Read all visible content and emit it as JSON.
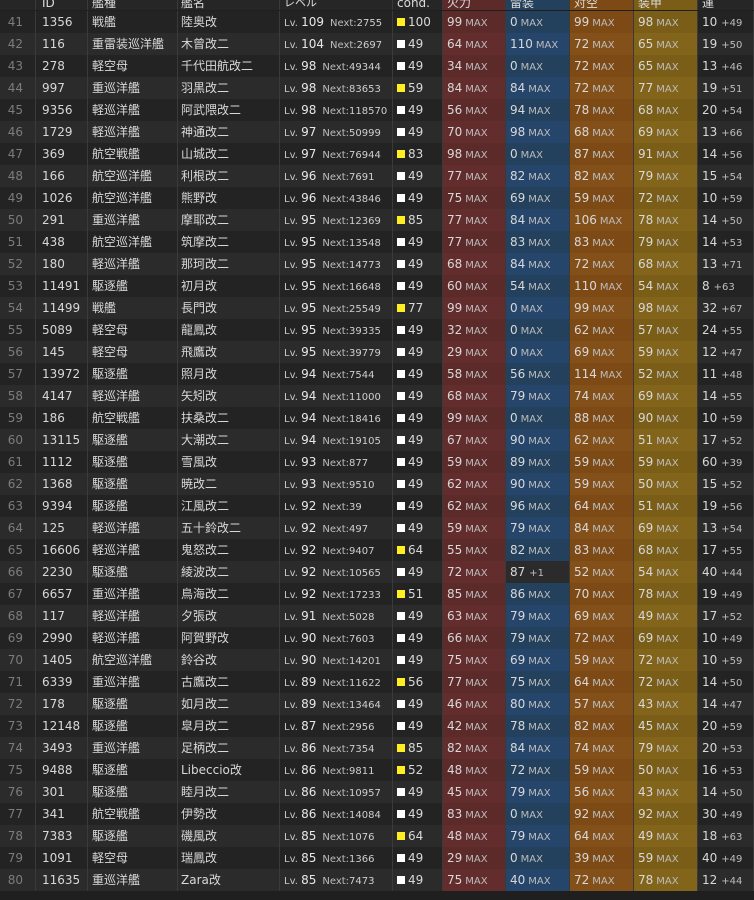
{
  "columns": {
    "id": "ID",
    "type": "艦種",
    "name": "艦名",
    "level": "レベル",
    "cond": "cond.",
    "firepower": "火力",
    "torpedo": "雷装",
    "antiair": "対空",
    "armor": "装甲",
    "luck": "運"
  },
  "labels": {
    "lv": "Lv.",
    "next": "Next:",
    "max": "MAX"
  },
  "colors": {
    "cond_yellow": "#ffee22",
    "cond_white": "#ffffff"
  },
  "rows": [
    {
      "idx": "41",
      "id": "1356",
      "type": "戦艦",
      "name": "陸奥改",
      "lv": "109",
      "next": "2755",
      "cond": "100",
      "cy": true,
      "fire": "99",
      "torp": "0",
      "aa": "99",
      "arm": "98",
      "luck": "10",
      "luck_plus": "+49"
    },
    {
      "idx": "42",
      "id": "116",
      "type": "重雷装巡洋艦",
      "name": "木曾改二",
      "lv": "104",
      "next": "2697",
      "cond": "49",
      "cy": false,
      "fire": "64",
      "torp": "110",
      "aa": "72",
      "arm": "65",
      "luck": "19",
      "luck_plus": "+50"
    },
    {
      "idx": "43",
      "id": "278",
      "type": "軽空母",
      "name": "千代田航改二",
      "lv": "98",
      "next": "49344",
      "cond": "49",
      "cy": false,
      "fire": "34",
      "torp": "0",
      "aa": "72",
      "arm": "65",
      "luck": "13",
      "luck_plus": "+46"
    },
    {
      "idx": "44",
      "id": "997",
      "type": "重巡洋艦",
      "name": "羽黒改二",
      "lv": "98",
      "next": "83653",
      "cond": "59",
      "cy": true,
      "fire": "84",
      "torp": "84",
      "aa": "72",
      "arm": "77",
      "luck": "19",
      "luck_plus": "+51"
    },
    {
      "idx": "45",
      "id": "9356",
      "type": "軽巡洋艦",
      "name": "阿武隈改二",
      "lv": "98",
      "next": "118570",
      "cond": "49",
      "cy": false,
      "fire": "56",
      "torp": "94",
      "aa": "78",
      "arm": "68",
      "luck": "20",
      "luck_plus": "+54"
    },
    {
      "idx": "46",
      "id": "1729",
      "type": "軽巡洋艦",
      "name": "神通改二",
      "lv": "97",
      "next": "50999",
      "cond": "49",
      "cy": false,
      "fire": "70",
      "torp": "98",
      "aa": "68",
      "arm": "69",
      "luck": "13",
      "luck_plus": "+66"
    },
    {
      "idx": "47",
      "id": "369",
      "type": "航空戦艦",
      "name": "山城改二",
      "lv": "97",
      "next": "76944",
      "cond": "83",
      "cy": true,
      "fire": "98",
      "torp": "0",
      "aa": "87",
      "arm": "91",
      "luck": "14",
      "luck_plus": "+56"
    },
    {
      "idx": "48",
      "id": "166",
      "type": "航空巡洋艦",
      "name": "利根改二",
      "lv": "96",
      "next": "7691",
      "cond": "49",
      "cy": false,
      "fire": "77",
      "torp": "82",
      "aa": "82",
      "arm": "79",
      "luck": "15",
      "luck_plus": "+54"
    },
    {
      "idx": "49",
      "id": "1026",
      "type": "航空巡洋艦",
      "name": "熊野改",
      "lv": "96",
      "next": "43846",
      "cond": "49",
      "cy": false,
      "fire": "75",
      "torp": "69",
      "aa": "59",
      "arm": "72",
      "luck": "10",
      "luck_plus": "+59"
    },
    {
      "idx": "50",
      "id": "291",
      "type": "重巡洋艦",
      "name": "摩耶改二",
      "lv": "95",
      "next": "12369",
      "cond": "85",
      "cy": true,
      "fire": "77",
      "torp": "84",
      "aa": "106",
      "arm": "78",
      "luck": "14",
      "luck_plus": "+50"
    },
    {
      "idx": "51",
      "id": "438",
      "type": "航空巡洋艦",
      "name": "筑摩改二",
      "lv": "95",
      "next": "13548",
      "cond": "49",
      "cy": false,
      "fire": "77",
      "torp": "83",
      "aa": "83",
      "arm": "79",
      "luck": "14",
      "luck_plus": "+53"
    },
    {
      "idx": "52",
      "id": "180",
      "type": "軽巡洋艦",
      "name": "那珂改二",
      "lv": "95",
      "next": "14773",
      "cond": "49",
      "cy": false,
      "fire": "68",
      "torp": "84",
      "aa": "72",
      "arm": "68",
      "luck": "13",
      "luck_plus": "+71"
    },
    {
      "idx": "53",
      "id": "11491",
      "type": "駆逐艦",
      "name": "初月改",
      "lv": "95",
      "next": "16648",
      "cond": "49",
      "cy": false,
      "fire": "60",
      "torp": "54",
      "aa": "110",
      "arm": "54",
      "luck": "8",
      "luck_plus": "+63"
    },
    {
      "idx": "54",
      "id": "11499",
      "type": "戦艦",
      "name": "長門改",
      "lv": "95",
      "next": "25549",
      "cond": "77",
      "cy": true,
      "fire": "99",
      "torp": "0",
      "aa": "99",
      "arm": "98",
      "luck": "32",
      "luck_plus": "+67"
    },
    {
      "idx": "55",
      "id": "5089",
      "type": "軽空母",
      "name": "龍鳳改",
      "lv": "95",
      "next": "39335",
      "cond": "49",
      "cy": false,
      "fire": "32",
      "torp": "0",
      "aa": "62",
      "arm": "57",
      "luck": "24",
      "luck_plus": "+55"
    },
    {
      "idx": "56",
      "id": "145",
      "type": "軽空母",
      "name": "飛鷹改",
      "lv": "95",
      "next": "39779",
      "cond": "49",
      "cy": false,
      "fire": "29",
      "torp": "0",
      "aa": "69",
      "arm": "59",
      "luck": "12",
      "luck_plus": "+47"
    },
    {
      "idx": "57",
      "id": "13972",
      "type": "駆逐艦",
      "name": "照月改",
      "lv": "94",
      "next": "7544",
      "cond": "49",
      "cy": false,
      "fire": "58",
      "torp": "56",
      "aa": "114",
      "arm": "52",
      "luck": "11",
      "luck_plus": "+48"
    },
    {
      "idx": "58",
      "id": "4147",
      "type": "軽巡洋艦",
      "name": "矢矧改",
      "lv": "94",
      "next": "11000",
      "cond": "49",
      "cy": false,
      "fire": "68",
      "torp": "79",
      "aa": "74",
      "arm": "69",
      "luck": "14",
      "luck_plus": "+55"
    },
    {
      "idx": "59",
      "id": "186",
      "type": "航空戦艦",
      "name": "扶桑改二",
      "lv": "94",
      "next": "18416",
      "cond": "49",
      "cy": false,
      "fire": "99",
      "torp": "0",
      "aa": "88",
      "arm": "90",
      "luck": "10",
      "luck_plus": "+59"
    },
    {
      "idx": "60",
      "id": "13115",
      "type": "駆逐艦",
      "name": "大潮改二",
      "lv": "94",
      "next": "19105",
      "cond": "49",
      "cy": false,
      "fire": "67",
      "torp": "90",
      "aa": "62",
      "arm": "51",
      "luck": "17",
      "luck_plus": "+52"
    },
    {
      "idx": "61",
      "id": "1112",
      "type": "駆逐艦",
      "name": "雪風改",
      "lv": "93",
      "next": "877",
      "cond": "49",
      "cy": false,
      "fire": "59",
      "torp": "89",
      "aa": "59",
      "arm": "59",
      "luck": "60",
      "luck_plus": "+39"
    },
    {
      "idx": "62",
      "id": "1368",
      "type": "駆逐艦",
      "name": "暁改二",
      "lv": "93",
      "next": "9510",
      "cond": "49",
      "cy": false,
      "fire": "62",
      "torp": "90",
      "aa": "59",
      "arm": "50",
      "luck": "15",
      "luck_plus": "+52"
    },
    {
      "idx": "63",
      "id": "9394",
      "type": "駆逐艦",
      "name": "江風改二",
      "lv": "92",
      "next": "39",
      "cond": "49",
      "cy": false,
      "fire": "62",
      "torp": "96",
      "aa": "64",
      "arm": "51",
      "luck": "19",
      "luck_plus": "+56"
    },
    {
      "idx": "64",
      "id": "125",
      "type": "軽巡洋艦",
      "name": "五十鈴改二",
      "lv": "92",
      "next": "497",
      "cond": "49",
      "cy": false,
      "fire": "59",
      "torp": "79",
      "aa": "84",
      "arm": "69",
      "luck": "13",
      "luck_plus": "+54"
    },
    {
      "idx": "65",
      "id": "16606",
      "type": "軽巡洋艦",
      "name": "鬼怒改二",
      "lv": "92",
      "next": "9407",
      "cond": "64",
      "cy": true,
      "fire": "55",
      "torp": "82",
      "aa": "83",
      "arm": "68",
      "luck": "17",
      "luck_plus": "+55"
    },
    {
      "idx": "66",
      "id": "2230",
      "type": "駆逐艦",
      "name": "綾波改二",
      "lv": "92",
      "next": "10565",
      "cond": "49",
      "cy": false,
      "fire": "72",
      "torp": "87",
      "torp_plus": "+1",
      "aa": "52",
      "arm": "54",
      "luck": "40",
      "luck_plus": "+44"
    },
    {
      "idx": "67",
      "id": "6657",
      "type": "重巡洋艦",
      "name": "鳥海改二",
      "lv": "92",
      "next": "17233",
      "cond": "51",
      "cy": true,
      "fire": "85",
      "torp": "86",
      "aa": "70",
      "arm": "78",
      "luck": "19",
      "luck_plus": "+49"
    },
    {
      "idx": "68",
      "id": "117",
      "type": "軽巡洋艦",
      "name": "夕張改",
      "lv": "91",
      "next": "5028",
      "cond": "49",
      "cy": false,
      "fire": "63",
      "torp": "79",
      "aa": "69",
      "arm": "49",
      "luck": "17",
      "luck_plus": "+52"
    },
    {
      "idx": "69",
      "id": "2990",
      "type": "軽巡洋艦",
      "name": "阿賀野改",
      "lv": "90",
      "next": "7603",
      "cond": "49",
      "cy": false,
      "fire": "66",
      "torp": "79",
      "aa": "72",
      "arm": "69",
      "luck": "10",
      "luck_plus": "+49"
    },
    {
      "idx": "70",
      "id": "1405",
      "type": "航空巡洋艦",
      "name": "鈴谷改",
      "lv": "90",
      "next": "14201",
      "cond": "49",
      "cy": false,
      "fire": "75",
      "torp": "69",
      "aa": "59",
      "arm": "72",
      "luck": "10",
      "luck_plus": "+59"
    },
    {
      "idx": "71",
      "id": "6339",
      "type": "重巡洋艦",
      "name": "古鷹改二",
      "lv": "89",
      "next": "11622",
      "cond": "56",
      "cy": true,
      "fire": "77",
      "torp": "75",
      "aa": "64",
      "arm": "72",
      "luck": "14",
      "luck_plus": "+50"
    },
    {
      "idx": "72",
      "id": "178",
      "type": "駆逐艦",
      "name": "如月改二",
      "lv": "89",
      "next": "13464",
      "cond": "49",
      "cy": false,
      "fire": "46",
      "torp": "80",
      "aa": "57",
      "arm": "43",
      "luck": "14",
      "luck_plus": "+47"
    },
    {
      "idx": "73",
      "id": "12148",
      "type": "駆逐艦",
      "name": "皐月改二",
      "lv": "87",
      "next": "2956",
      "cond": "49",
      "cy": false,
      "fire": "42",
      "torp": "78",
      "aa": "82",
      "arm": "45",
      "luck": "20",
      "luck_plus": "+59"
    },
    {
      "idx": "74",
      "id": "3493",
      "type": "重巡洋艦",
      "name": "足柄改二",
      "lv": "86",
      "next": "7354",
      "cond": "85",
      "cy": true,
      "fire": "82",
      "torp": "84",
      "aa": "74",
      "arm": "79",
      "luck": "20",
      "luck_plus": "+53"
    },
    {
      "idx": "75",
      "id": "9488",
      "type": "駆逐艦",
      "name": "Libeccio改",
      "lv": "86",
      "next": "9811",
      "cond": "52",
      "cy": true,
      "fire": "48",
      "torp": "72",
      "aa": "59",
      "arm": "50",
      "luck": "16",
      "luck_plus": "+53"
    },
    {
      "idx": "76",
      "id": "301",
      "type": "駆逐艦",
      "name": "睦月改二",
      "lv": "86",
      "next": "10957",
      "cond": "49",
      "cy": false,
      "fire": "45",
      "torp": "79",
      "aa": "56",
      "arm": "43",
      "luck": "14",
      "luck_plus": "+50"
    },
    {
      "idx": "77",
      "id": "341",
      "type": "航空戦艦",
      "name": "伊勢改",
      "lv": "86",
      "next": "14084",
      "cond": "49",
      "cy": false,
      "fire": "83",
      "torp": "0",
      "aa": "92",
      "arm": "92",
      "luck": "30",
      "luck_plus": "+49"
    },
    {
      "idx": "78",
      "id": "7383",
      "type": "駆逐艦",
      "name": "磯風改",
      "lv": "85",
      "next": "1076",
      "cond": "64",
      "cy": true,
      "fire": "48",
      "torp": "79",
      "aa": "64",
      "arm": "49",
      "luck": "18",
      "luck_plus": "+63"
    },
    {
      "idx": "79",
      "id": "1091",
      "type": "軽空母",
      "name": "瑞鳳改",
      "lv": "85",
      "next": "1366",
      "cond": "49",
      "cy": false,
      "fire": "29",
      "torp": "0",
      "aa": "39",
      "arm": "59",
      "luck": "40",
      "luck_plus": "+49"
    },
    {
      "idx": "80",
      "id": "11635",
      "type": "重巡洋艦",
      "name": "Zara改",
      "lv": "85",
      "next": "7473",
      "cond": "49",
      "cy": false,
      "fire": "75",
      "torp": "40",
      "aa": "72",
      "arm": "78",
      "luck": "12",
      "luck_plus": "+44"
    }
  ]
}
